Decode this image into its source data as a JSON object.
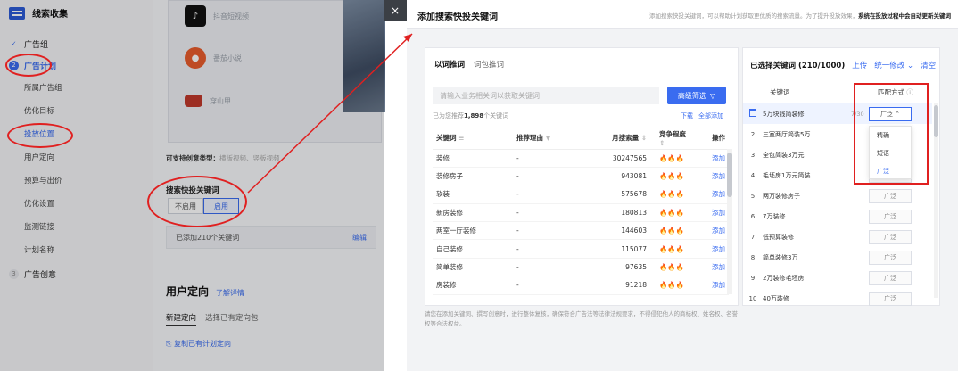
{
  "app": {
    "title": "线索收集"
  },
  "sidebar": {
    "steps": [
      {
        "num": "✓",
        "label": "广告组",
        "state": "done"
      },
      {
        "num": "2",
        "label": "广告计划",
        "state": "active"
      }
    ],
    "sub_items": [
      "所属广告组",
      "优化目标",
      "投放位置",
      "用户定向",
      "预算与出价",
      "优化设置",
      "监测链接",
      "计划名称"
    ],
    "selected_sub": "投放位置",
    "step3": {
      "num": "3",
      "label": "广告创意"
    }
  },
  "background_form": {
    "media_items": [
      "抖音短视频",
      "番茄小说",
      "穿山甲"
    ],
    "support_types_label": "可支持创意类型：",
    "support_types_value": "横版视频、竖版视频",
    "search_kw_label": "搜索快投关键词",
    "toggle_off": "不启用",
    "toggle_on": "启用",
    "added_text": "已添加210个关键词",
    "edit_label": "编辑",
    "user_target_title": "用户定向",
    "user_target_link": "了解详情",
    "tgt_tabs": [
      "新建定向",
      "选择已有定向包"
    ],
    "copy_link": "复制已有计划定向"
  },
  "modal": {
    "title": "添加搜索快投关键词",
    "desc_plain": "添加搜索快投关键词，可以帮助计划获取更优质的搜索流量。为了提升投放效果，",
    "desc_bold": "系统在投放过程中会自动更新关键词",
    "close_label": "×",
    "left": {
      "tabs": [
        "以词推词",
        "词包推词"
      ],
      "search_placeholder": "请输入业务相关词以获取关键词",
      "adv_filter": "高级筛选",
      "rec_count_prefix": "已为您推荐",
      "rec_count_value": "1,898",
      "rec_count_suffix": "个关键词",
      "download": "下载",
      "add_all": "全部添加",
      "columns": [
        "关键词",
        "推荐理由",
        "月搜索量",
        "竞争程度",
        "操作"
      ],
      "rows": [
        {
          "kw": "装修",
          "reason": "-",
          "volume": "30247565",
          "comp": "🔥🔥🔥",
          "op": "添加"
        },
        {
          "kw": "装修房子",
          "reason": "-",
          "volume": "943081",
          "comp": "🔥🔥🔥",
          "op": "添加"
        },
        {
          "kw": "软装",
          "reason": "-",
          "volume": "575678",
          "comp": "🔥🔥🔥",
          "op": "添加"
        },
        {
          "kw": "新房装修",
          "reason": "-",
          "volume": "180813",
          "comp": "🔥🔥🔥",
          "op": "添加"
        },
        {
          "kw": "两室一厅装修",
          "reason": "-",
          "volume": "144603",
          "comp": "🔥🔥🔥",
          "op": "添加"
        },
        {
          "kw": "自己装修",
          "reason": "-",
          "volume": "115077",
          "comp": "🔥🔥🔥",
          "op": "添加"
        },
        {
          "kw": "简单装修",
          "reason": "-",
          "volume": "97635",
          "comp": "🔥🔥🔥",
          "op": "添加"
        },
        {
          "kw": "房装修",
          "reason": "-",
          "volume": "91218",
          "comp": "🔥🔥🔥",
          "op": "添加"
        }
      ],
      "disclaimer": "请您在添加关键词、撰写创意时，进行整体复核，确保符合广告法等法律法规要求，不得侵犯他人的商标权、姓名权、名誉权等合法权益。"
    },
    "right": {
      "title": "已选择关键词 (210/1000)",
      "upload": "上传",
      "batch_edit": "统一修改",
      "clear": "清空",
      "col_kw": "关键词",
      "col_match": "匹配方式",
      "first_row_count": "7/30",
      "rows": [
        {
          "idx": "",
          "kw": "5万块钱简装修",
          "match": "广泛"
        },
        {
          "idx": "2",
          "kw": "三室两厅简装5万",
          "match": "广泛"
        },
        {
          "idx": "3",
          "kw": "全包简装3万元",
          "match": "广泛"
        },
        {
          "idx": "4",
          "kw": "毛坯房1万元简装",
          "match": "广泛"
        },
        {
          "idx": "5",
          "kw": "两万装修房子",
          "match": "广泛"
        },
        {
          "idx": "6",
          "kw": "7万装修",
          "match": "广泛"
        },
        {
          "idx": "7",
          "kw": "低预算装修",
          "match": "广泛"
        },
        {
          "idx": "8",
          "kw": "简单装修3万",
          "match": "广泛"
        },
        {
          "idx": "9",
          "kw": "2万装修毛坯房",
          "match": "广泛"
        },
        {
          "idx": "10",
          "kw": "40万装修",
          "match": "广泛"
        }
      ],
      "dropdown_options": [
        "精确",
        "短语",
        "广泛"
      ],
      "dropdown_selected": "广泛"
    }
  },
  "colors": {
    "accent": "#3a6cf0",
    "annotation": "#e02020",
    "fire": "#f28a25"
  }
}
